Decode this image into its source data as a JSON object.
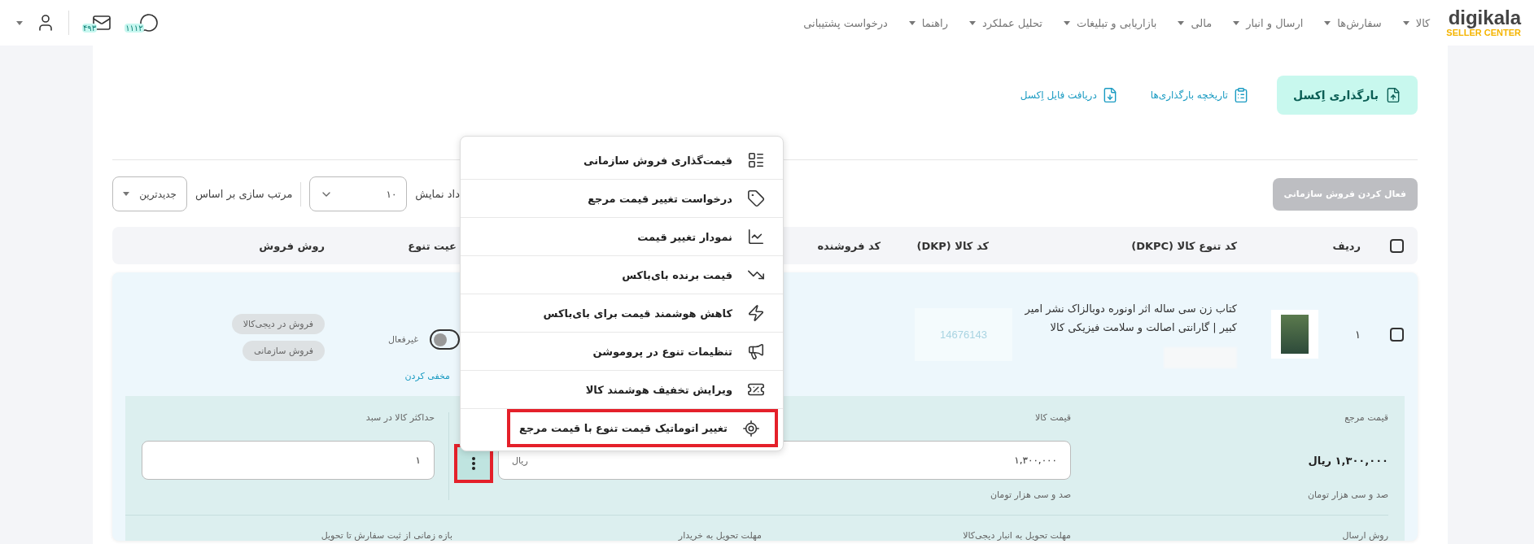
{
  "header": {
    "logo": {
      "name": "digikala",
      "subtitle": "SELLER CENTER"
    },
    "nav": [
      {
        "label": "کالا",
        "has_caret": true
      },
      {
        "label": "سفارش‌ها",
        "has_caret": true
      },
      {
        "label": "ارسال و انبار",
        "has_caret": true
      },
      {
        "label": "مالی",
        "has_caret": true
      },
      {
        "label": "بازاریابی و تبلیغات",
        "has_caret": true
      },
      {
        "label": "تحلیل عملکرد",
        "has_caret": true
      },
      {
        "label": "راهنما",
        "has_caret": true
      },
      {
        "label": "درخواست پشتیبانی",
        "has_caret": false
      }
    ],
    "notifications": [
      {
        "kind": "chat",
        "count": "۱۱۱۲"
      },
      {
        "kind": "mail",
        "count": "۴۹۳"
      }
    ]
  },
  "actions": [
    {
      "kind": "upload",
      "label": "بارگذاری اِکسل"
    },
    {
      "kind": "history",
      "label": "تاریخچه بارگذاری‌ها"
    },
    {
      "kind": "download",
      "label": "دریافت فایل اِکسل"
    }
  ],
  "toolbar": {
    "activate_button": {
      "label": "فعال کردن فروش سازمانی",
      "disabled": true
    },
    "page_size": {
      "label": "داد نمایش",
      "value": "۱۰"
    },
    "sort": {
      "label": "مرتب سازی بر اساس",
      "value": "جدیدترین"
    }
  },
  "table": {
    "all_checked": false,
    "columns": [
      "ردیف",
      "کد تنوع کالا (DKPC)",
      "کد کالا (DKP)",
      "کد فروشنده",
      "عیت تنوع",
      "روش فروش"
    ],
    "rows": [
      {
        "checked": false,
        "index": "۱",
        "title": "کتاب زن سی ساله اثر اونوره دوبالزاک نشر امیر کبیر | گارانتی اصالت و سلامت فیزیکی کالا",
        "dkp": "14676143",
        "status": {
          "on": false,
          "label": "غیرفعال"
        },
        "hide_link": "مخفی کردن",
        "sales_methods": [
          "فروش در دیجی‌کالا",
          "فروش سازمانی"
        ],
        "details": {
          "reference_price": {
            "label": "قیمت مرجع",
            "value": "۱,۳۰۰,۰۰۰ ریال",
            "words": "صد و سی هزار تومان"
          },
          "price": {
            "label": "قیمت کالا",
            "value": "۱,۳۰۰,۰۰۰",
            "unit": "ریال",
            "words": "صد و سی هزار تومان"
          },
          "more_button": {
            "highlighted": true
          },
          "max_in_cart": {
            "label": "حداکثر کالا در سبد",
            "value": "۱"
          },
          "shipping_labels": [
            "روش ارسال",
            "مهلت تحویل به انبار دیجی‌کالا",
            "مهلت تحویل به خریدار",
            "بازه زمانی از ثبت سفارش تا تحویل"
          ]
        }
      }
    ]
  },
  "menu": {
    "items": [
      {
        "kind": "org-pricing",
        "label": "قیمت‌گذاری فروش سازمانی",
        "highlighted": false
      },
      {
        "kind": "tag",
        "label": "درخواست تغییر قیمت مرجع",
        "highlighted": false
      },
      {
        "kind": "chart",
        "label": "نمودار تغییر قیمت",
        "highlighted": false
      },
      {
        "kind": "trend",
        "label": "قیمت برنده بای‌باکس",
        "highlighted": false
      },
      {
        "kind": "bolt",
        "label": "کاهش هوشمند قیمت برای بای‌باکس",
        "highlighted": false
      },
      {
        "kind": "promo",
        "label": "تنظیمات تنوع در پروموشن",
        "highlighted": false
      },
      {
        "kind": "discount",
        "label": "ویرایش تخفیف هوشمند کالا",
        "highlighted": false
      },
      {
        "kind": "target",
        "label": "تغییر اتوماتیک قیمت تنوع با قیمت مرجع",
        "highlighted": true
      }
    ]
  }
}
